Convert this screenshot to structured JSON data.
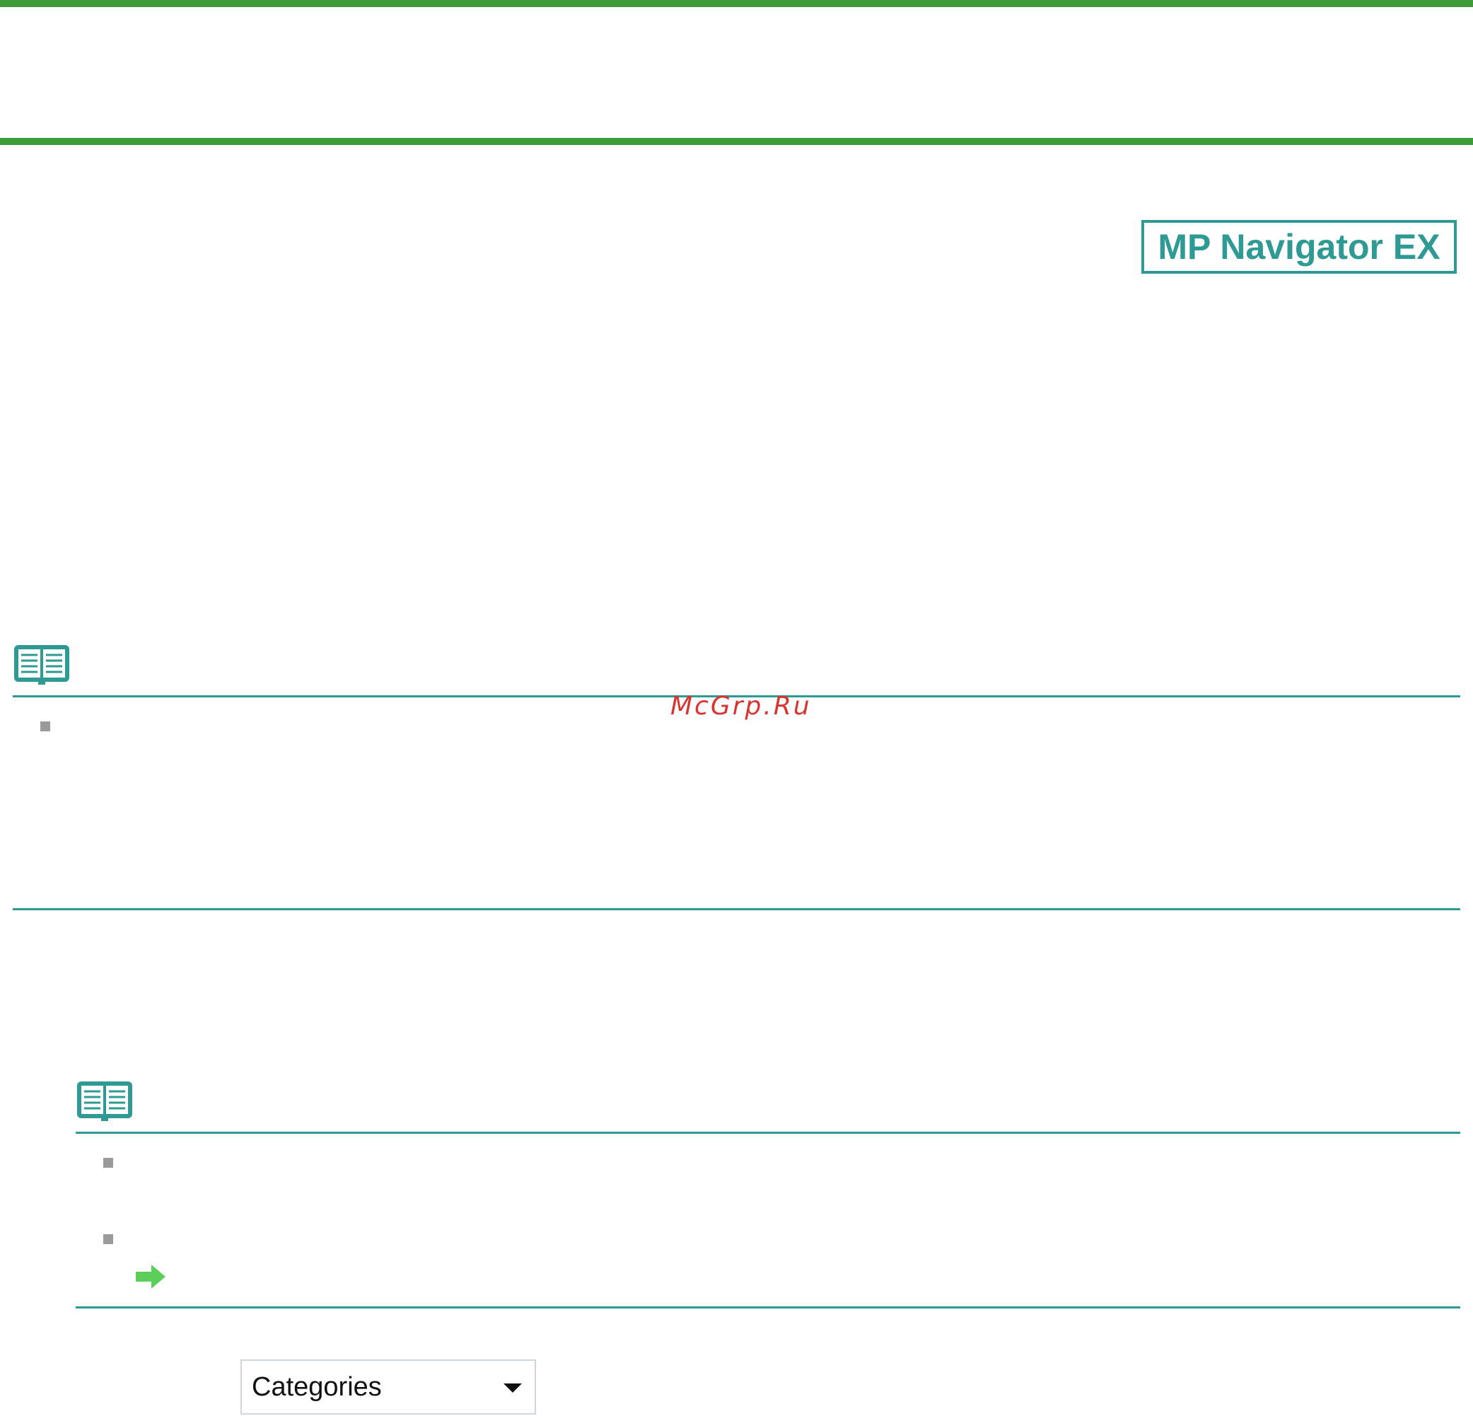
{
  "logo": {
    "text": "MP Navigator EX"
  },
  "watermark": {
    "text": "McGrp.Ru"
  },
  "dropdown": {
    "selected_value": "Categories"
  },
  "icons": {
    "note": "book-note-icon",
    "bullet": "gray-square-bullet-icon",
    "link_arrow": "green-arrow-icon",
    "dropdown_caret": "chevron-down-icon"
  },
  "colors": {
    "green_rule": "#3e9b3a",
    "teal": "#2f9a93",
    "bullet_gray": "#9a9a9a",
    "watermark_red": "#d9342f",
    "arrow_green": "#5ccf5a"
  }
}
